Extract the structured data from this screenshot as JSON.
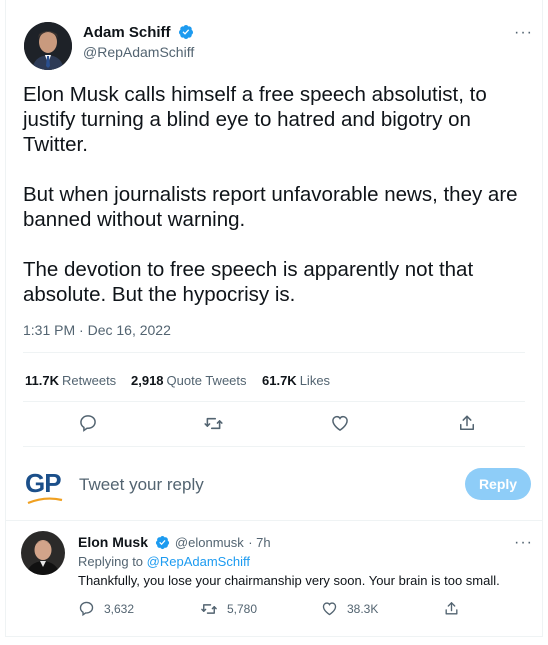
{
  "tweet": {
    "author_name": "Adam Schiff",
    "author_handle": "@RepAdamSchiff",
    "paragraphs": [
      "Elon Musk calls himself a free speech absolutist, to justify turning a blind eye to hatred and bigotry on Twitter.",
      "But when journalists report unfavorable news, they are banned without warning.",
      "The devotion to free speech is apparently not that absolute. But the hypocrisy is."
    ],
    "timestamp": "1:31 PM · Dec 16, 2022",
    "more_glyph": "···",
    "stats": {
      "retweets_count": "11.7K",
      "retweets_label": "Retweets",
      "quotes_count": "2,918",
      "quotes_label": "Quote Tweets",
      "likes_count": "61.7K",
      "likes_label": "Likes"
    }
  },
  "compose": {
    "logo_text": "GP",
    "placeholder": "Tweet your reply",
    "reply_button": "Reply"
  },
  "reply": {
    "author_name": "Elon Musk",
    "author_handle": "@elonmusk",
    "time": "· 7h",
    "replying_prefix": "Replying to",
    "replying_to": "@RepAdamSchiff",
    "text": "Thankfully, you lose your chairmanship very soon. Your brain is too small.",
    "more_glyph": "···",
    "counts": {
      "replies": "3,632",
      "retweets": "5,780",
      "likes": "38.3K"
    }
  },
  "colors": {
    "accent": "#1d9bf0",
    "reply_button_disabled": "#8ecdf8",
    "secondary_text": "#536471",
    "divider": "#eff3f4"
  },
  "icons": [
    "verified-badge-icon",
    "more-icon",
    "reply-icon",
    "retweet-icon",
    "like-icon",
    "share-icon"
  ]
}
